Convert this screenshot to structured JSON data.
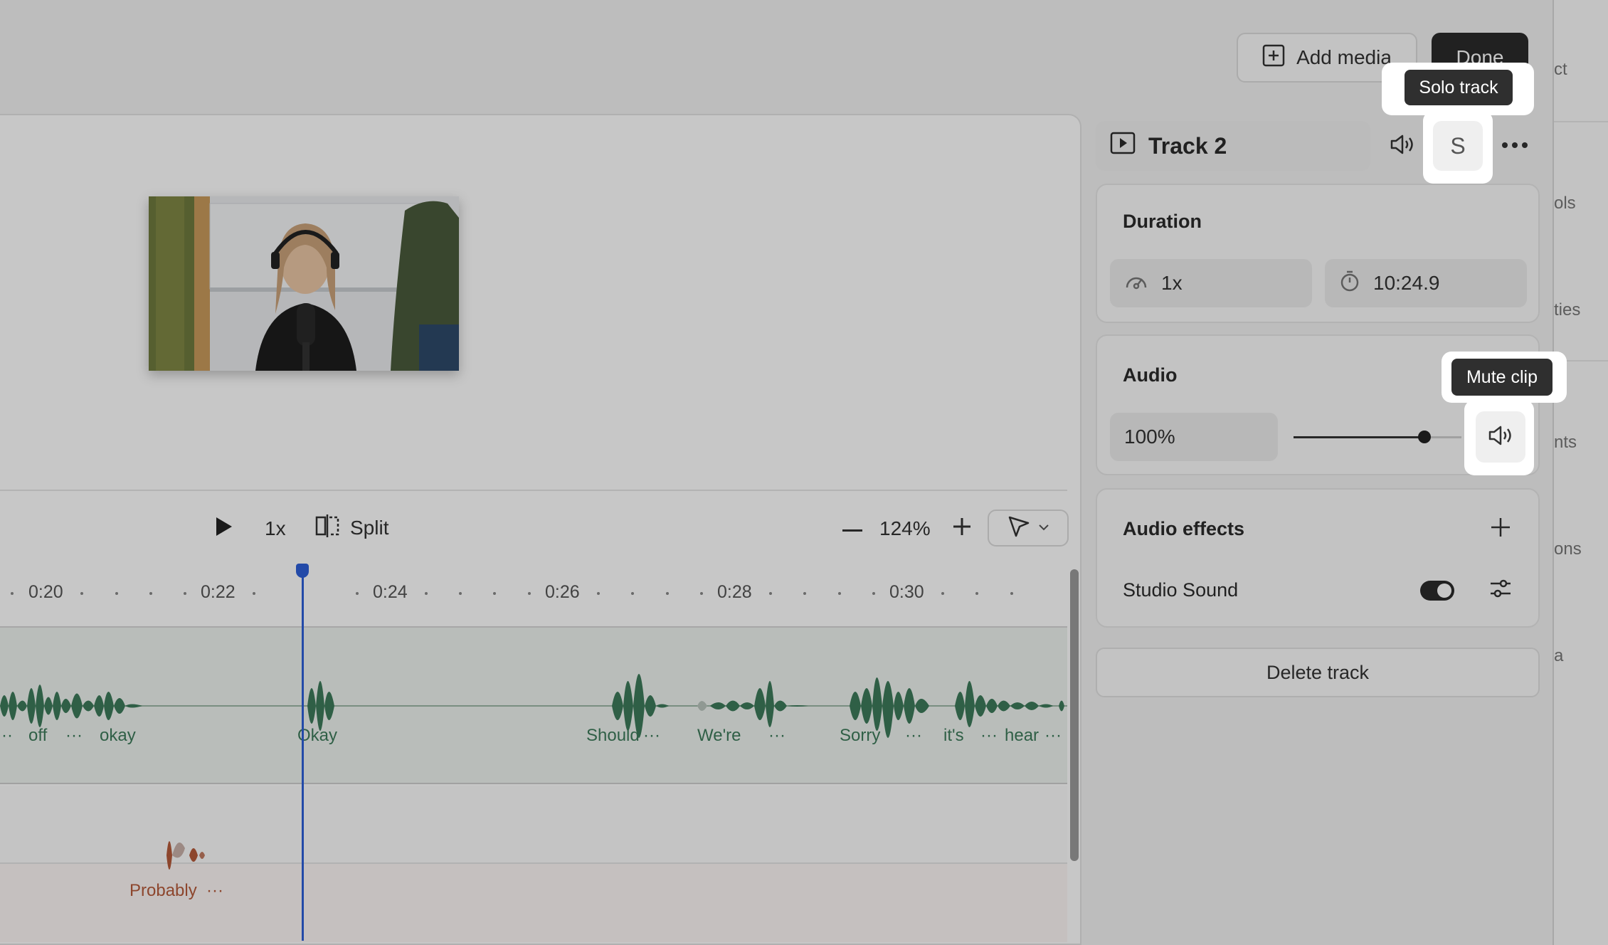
{
  "header": {
    "add_media_label": "Add media",
    "done_label": "Done"
  },
  "playback": {
    "speed": "1x",
    "split_label": "Split",
    "zoom": "124%"
  },
  "timeline": {
    "ticks": [
      "0:20",
      "0:22",
      "0:24",
      "0:26",
      "0:28",
      "0:30"
    ],
    "words_track_a": [
      "off",
      "okay",
      "Okay",
      "Should",
      "We're",
      "Sorry",
      "it's",
      "hear"
    ],
    "words_track_b": [
      "Probably"
    ],
    "ellipsis": "···"
  },
  "track_panel": {
    "title": "Track 2",
    "solo_label": "S",
    "duration": {
      "title": "Duration",
      "speed": "1x",
      "length": "10:24.9"
    },
    "audio": {
      "title": "Audio",
      "volume": "100%",
      "slider_level": 0.78
    },
    "audio_effects": {
      "title": "Audio effects",
      "items": [
        {
          "label": "Studio Sound",
          "enabled": true
        }
      ]
    },
    "delete_label": "Delete track"
  },
  "tooltips": {
    "solo": "Solo track",
    "mute": "Mute clip"
  },
  "underlay": [
    "ct",
    "ols",
    "ties",
    "nts",
    "ons",
    "a"
  ],
  "colors": {
    "accent": "#2d5fd8",
    "waveform_green": "#3d7a5a",
    "waveform_red": "#b55a3a"
  }
}
